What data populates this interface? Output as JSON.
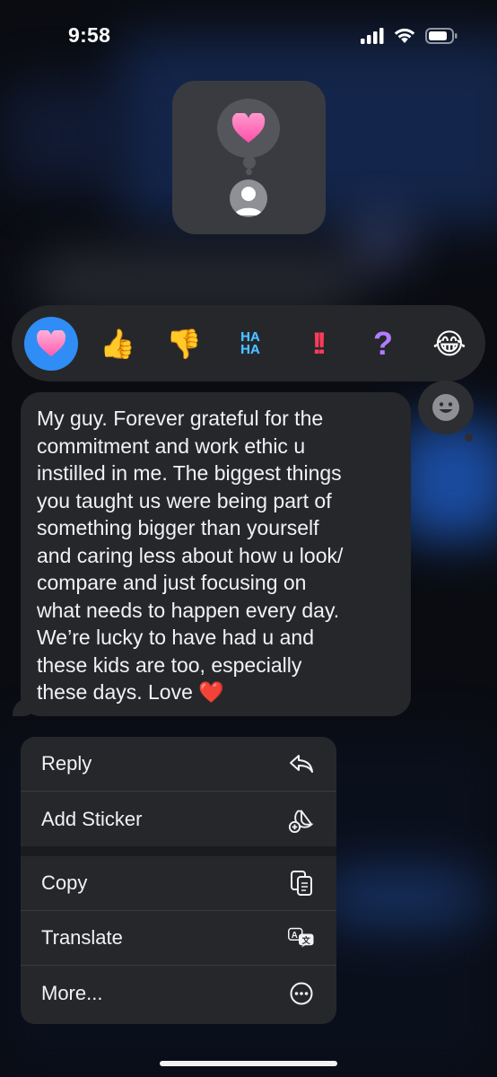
{
  "status_bar": {
    "time": "9:58",
    "icons": [
      "signal-icon",
      "wifi-icon",
      "battery-icon"
    ]
  },
  "reaction_preview": {
    "reaction": "❤️",
    "icons": [
      "heart-icon",
      "avatar-placeholder-icon"
    ]
  },
  "tapback": {
    "items": [
      {
        "name": "heart",
        "glyph": "🩷",
        "selected": true
      },
      {
        "name": "thumbs-up",
        "glyph": "👍"
      },
      {
        "name": "thumbs-down",
        "glyph": "👎"
      },
      {
        "name": "haha",
        "glyph": "HA HA"
      },
      {
        "name": "emphasize",
        "glyph": "‼"
      },
      {
        "name": "question",
        "glyph": "?"
      },
      {
        "name": "laugh-cry",
        "glyph": "😂"
      }
    ],
    "accent": "#2f8df5",
    "add_icon": "emoji-smiley-icon"
  },
  "message": {
    "text": "My guy. Forever grateful for the\ncommitment and work ethic u\ninstilled in me. The biggest things\nyou taught us were being part of\nsomething bigger than yourself\nand caring less about how u look/\ncompare and just focusing on\nwhat needs to happen every day.\nWe’re lucky to have had u and\nthese kids are too, especially\nthese days. Love ❤️"
  },
  "menu": {
    "group1": [
      {
        "label": "Reply",
        "icon": "reply-arrow-icon"
      },
      {
        "label": "Add Sticker",
        "icon": "add-sticker-icon"
      }
    ],
    "group2": [
      {
        "label": "Copy",
        "icon": "copy-document-icon"
      },
      {
        "label": "Translate",
        "icon": "translate-icon"
      },
      {
        "label": "More...",
        "icon": "ellipsis-circle-icon"
      }
    ]
  }
}
